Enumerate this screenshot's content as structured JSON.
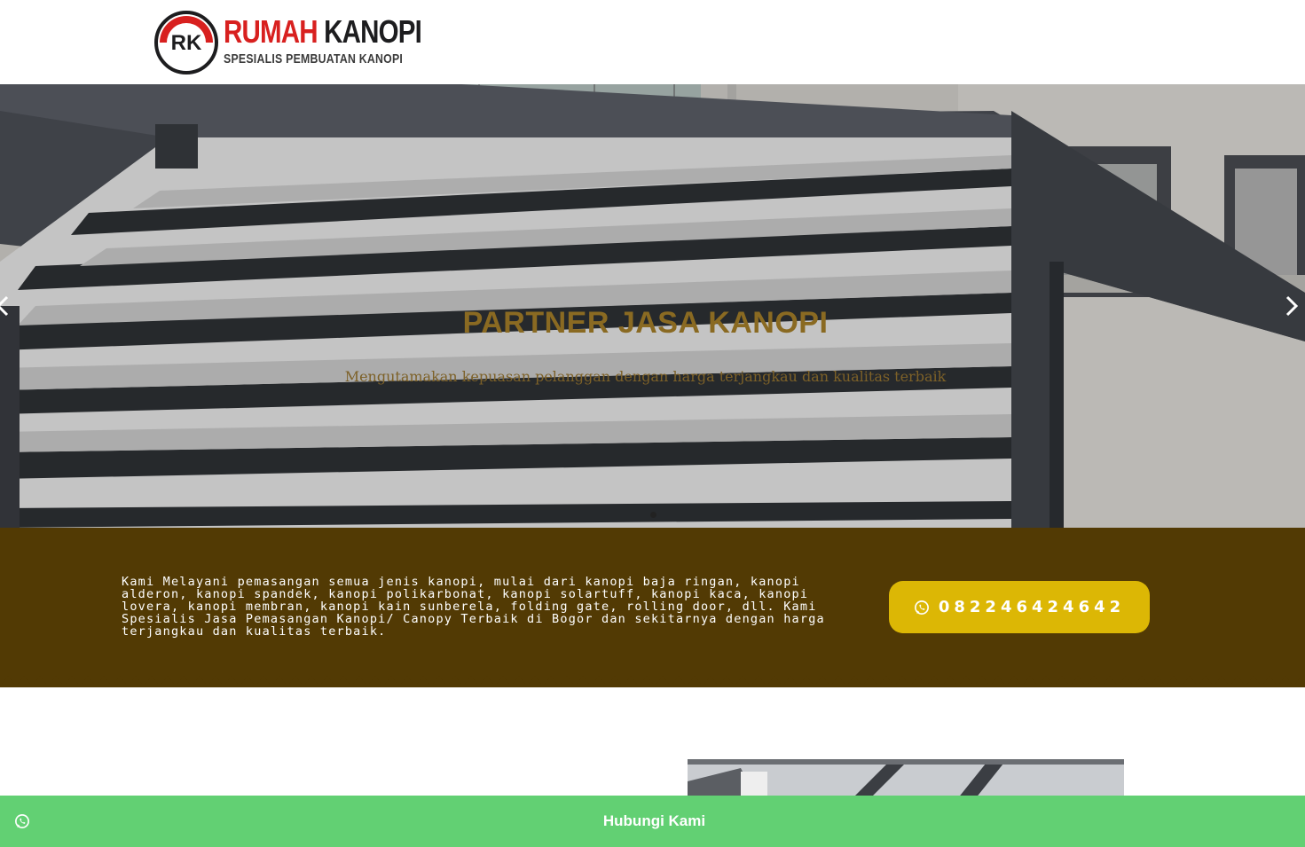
{
  "header": {
    "logo_mark": "RK",
    "logo_title_1": "RUMAH",
    "logo_title_2": "KANOPI",
    "logo_subtitle": "SPESIALIS PEMBUATAN KANOPI"
  },
  "hero": {
    "title": "PARTNER JASA KANOPI",
    "subtitle": "Mengutamakan kepuasan pelanggan dengan harga terjangkau dan kualitas terbaik",
    "prev_icon": "chevron-left-icon",
    "next_icon": "chevron-right-icon",
    "slides_total": 1,
    "active_slide": 1
  },
  "services": {
    "description": "Kami Melayani pemasangan semua jenis kanopi, mulai dari kanopi baja ringan, kanopi alderon, kanopi spandek, kanopi polikarbonat, kanopi solartuff, kanopi kaca, kanopi lovera, kanopi membran, kanopi kain sunberela, folding gate, rolling door, dll. Kami Spesialis Jasa Pemasangan Kanopi/ Canopy Terbaik di Bogor dan sekitarnya dengan harga terjangkau dan kualitas terbaik.",
    "phone_button": "082246424642",
    "phone_icon": "whatsapp-icon"
  },
  "bottom_bar": {
    "label": "Hubungi Kami",
    "icon": "whatsapp-icon"
  },
  "colors": {
    "brand_red": "#d8201f",
    "band_brown": "#523a04",
    "button_gold": "#dcb705",
    "hero_text_gold": "#8a6a22",
    "bottom_bar_green": "#62d073"
  }
}
